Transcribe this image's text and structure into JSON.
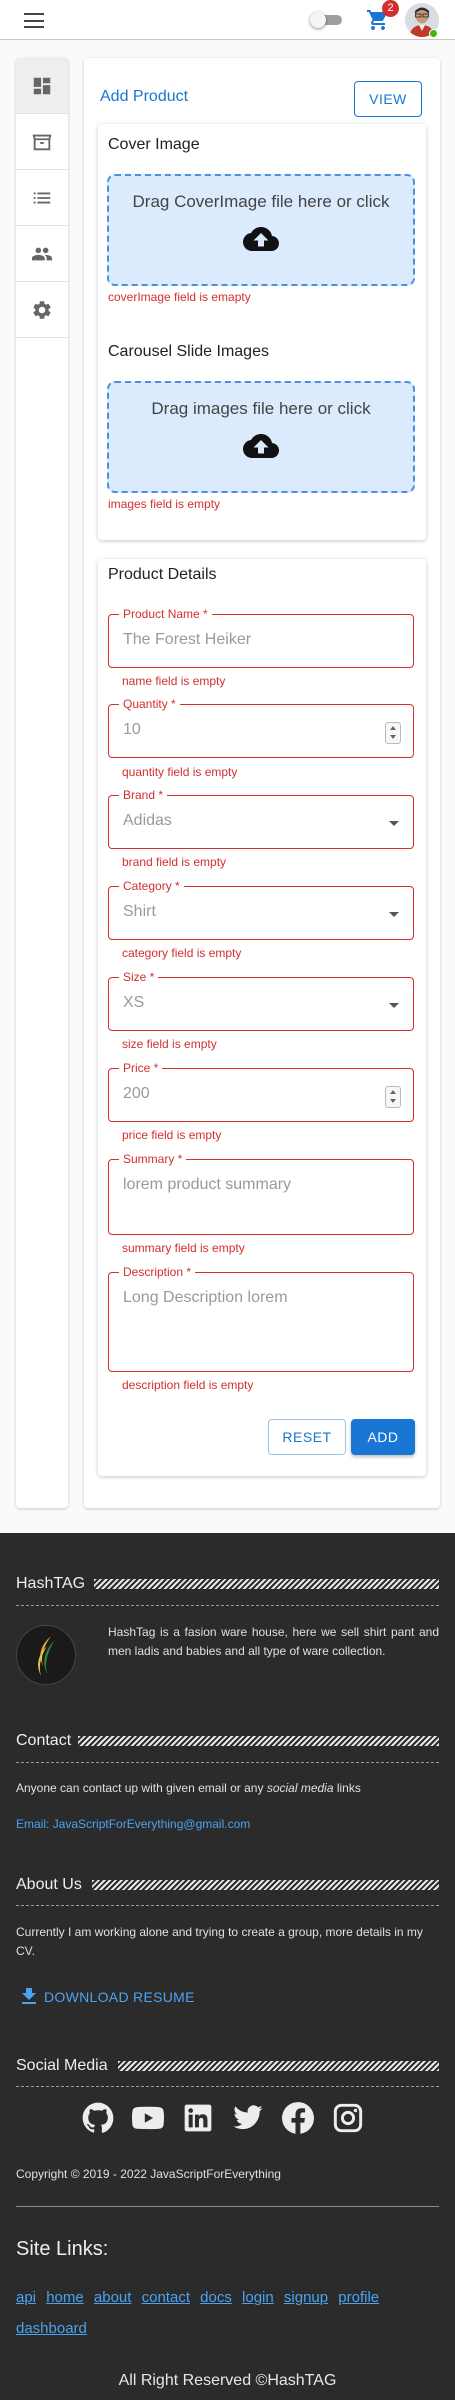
{
  "header": {
    "cart_count": "2"
  },
  "sidenav": {
    "items": [
      "dashboard-icon",
      "store-icon",
      "list-icon",
      "people-icon",
      "settings-icon"
    ]
  },
  "main": {
    "title": "Add Product",
    "view_label": "VIEW",
    "cover": {
      "title": "Cover Image",
      "drop_text": "Drag CoverImage file here or click",
      "error": "coverImage field is emapty"
    },
    "carousel": {
      "title": "Carousel Slide Images",
      "drop_text": "Drag images file here or click",
      "error": "images field is empty"
    },
    "details": {
      "title": "Product Details",
      "fields": [
        {
          "label": "Product Name *",
          "value": "The Forest Heiker",
          "error": "name field is empty"
        },
        {
          "label": "Quantity *",
          "value": "10",
          "error": "quantity field is empty"
        },
        {
          "label": "Brand *",
          "value": "Adidas",
          "error": "brand field is empty"
        },
        {
          "label": "Category *",
          "value": "Shirt",
          "error": "category field is empty"
        },
        {
          "label": "Size *",
          "value": "XS",
          "error": "size field is empty"
        },
        {
          "label": "Price *",
          "value": "200",
          "error": "price field is empty"
        },
        {
          "label": "Summary *",
          "value": "lorem product summary",
          "error": "summary field is empty"
        },
        {
          "label": "Description *",
          "value": "Long Description lorem",
          "error": "description field is empty"
        }
      ],
      "reset_label": "RESET",
      "add_label": "ADD"
    }
  },
  "footer": {
    "brand_title": "HashTAG",
    "brand_text": "HashTag is a fasion ware house, here we sell shirt pant and men ladis and babies and all type of ware collection.",
    "contact_title": "Contact",
    "contact_text_1": "Anyone can contact up with given email or any ",
    "contact_text_em": "social media",
    "contact_text_2": " links",
    "email": "Email: JavaScriptForEverything@gmail.com",
    "about_title": "About Us",
    "about_text": "Currently I am working alone and trying to create a group, more details in my CV.",
    "resume_label": "DOWNLOAD RESUME",
    "social_title": "Social Media",
    "social_icons": [
      "github-icon",
      "youtube-icon",
      "linkedin-icon",
      "twitter-icon",
      "facebook-icon",
      "instagram-icon"
    ],
    "copyright": "Copyright © 2019 - 2022 JavaScriptForEverything",
    "site_links_title": "Site Links:",
    "site_links": [
      "api",
      "home",
      "about",
      "contact",
      "docs",
      "login",
      "signup",
      "profile",
      "dashboard"
    ],
    "rights": "All Right Reserved ©HashTAG"
  },
  "colors": {
    "primary": "#1976d2",
    "error": "#d32f2f",
    "footer_bg": "#2b2b2b",
    "dropzone_bg": "#dbeafd"
  }
}
